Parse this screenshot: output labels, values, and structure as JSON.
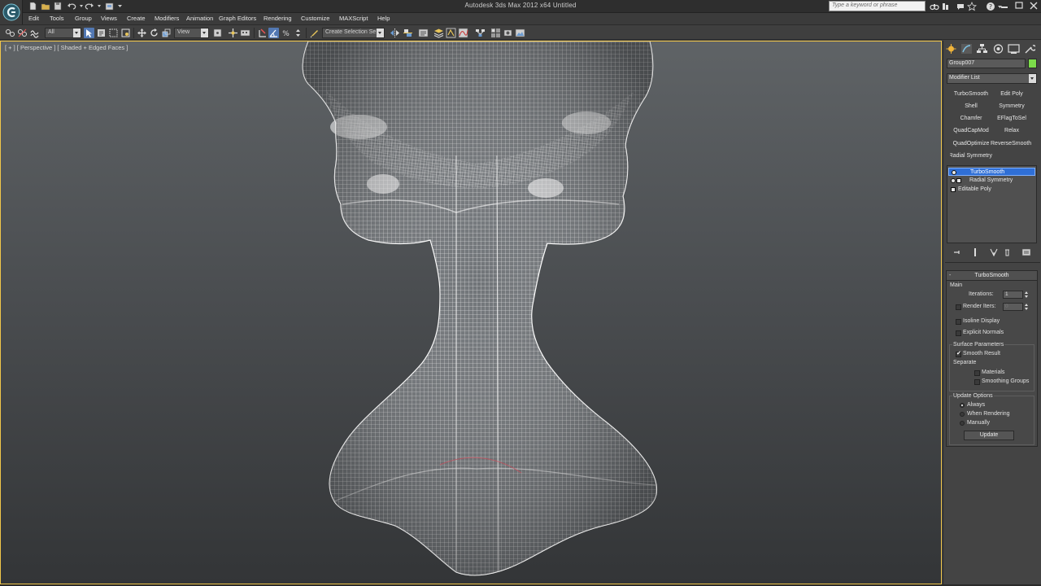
{
  "titlebar": {
    "title": "Autodesk 3ds Max  2012 x64      Untitled",
    "search_placeholder": "Type a keyword or phrase"
  },
  "menu": {
    "items": [
      "Edit",
      "Tools",
      "Group",
      "Views",
      "Create",
      "Modifiers",
      "Animation",
      "Graph Editors",
      "Rendering",
      "Customize",
      "MAXScript",
      "Help"
    ]
  },
  "toolbar": {
    "selection_filter": "All",
    "reference_coord": "View",
    "named_selection_placeholder": "Create Selection Se"
  },
  "viewport": {
    "label": "[ + ] [ Perspective ] [ Shaded + Edged Faces ]"
  },
  "command_panel": {
    "object_name": "Group007",
    "object_color": "#7cdc4a",
    "modifier_list_label": "Modifier List",
    "modifier_buttons": [
      "TurboSmooth",
      "Edit Poly",
      "Shell",
      "Symmetry",
      "Chamfer",
      "EFlagToSel",
      "QuadCapMod",
      "Relax",
      "QuadOptimize",
      "ReverseSmooth",
      "Radial Symmetry"
    ],
    "stack": [
      {
        "label": "TurboSmooth",
        "selected": true
      },
      {
        "label": "Radial Symmetry",
        "selected": false
      },
      {
        "label": "Editable Poly",
        "selected": false
      }
    ]
  },
  "turbosmooth": {
    "title": "TurboSmooth",
    "main_label": "Main",
    "iterations_label": "Iterations:",
    "iterations_value": "1",
    "render_iters_label": "Render Iters:",
    "render_iters_value": "0",
    "isoline_label": "Isoline Display",
    "explicit_normals_label": "Explicit Normals",
    "surface_params_label": "Surface Parameters",
    "smooth_result_label": "Smooth Result",
    "separate_label": "Separate",
    "materials_label": "Materials",
    "smoothing_groups_label": "Smoothing Groups",
    "update_options_label": "Update Options",
    "always_label": "Always",
    "when_rendering_label": "When Rendering",
    "manually_label": "Manually",
    "update_button": "Update",
    "smooth_result_checked": true,
    "update_mode": "Always"
  }
}
